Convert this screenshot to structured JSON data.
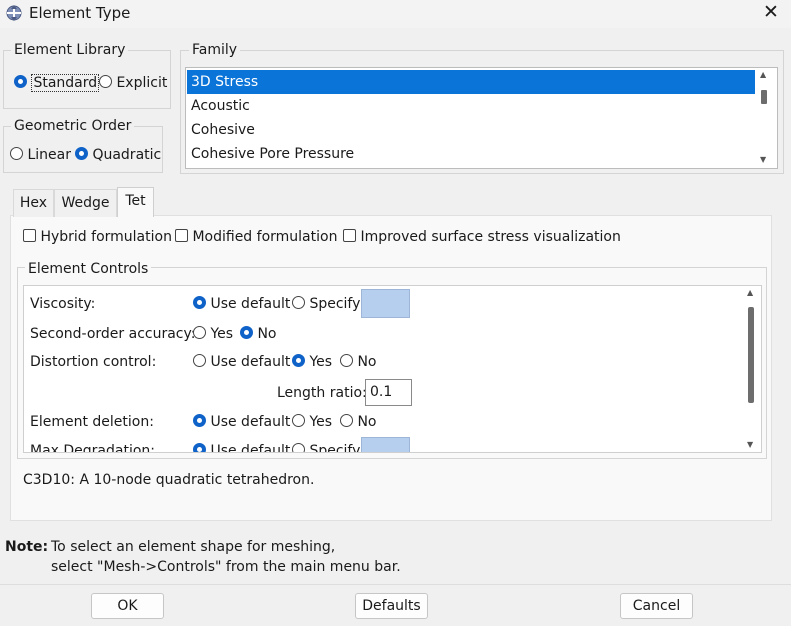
{
  "window": {
    "title": "Element Type",
    "close_glyph": "✕"
  },
  "element_library": {
    "legend": "Element Library",
    "options": [
      {
        "label": "Standard",
        "selected": true
      },
      {
        "label": "Explicit",
        "selected": false
      }
    ]
  },
  "geometric_order": {
    "legend": "Geometric Order",
    "options": [
      {
        "label": "Linear",
        "selected": false
      },
      {
        "label": "Quadratic",
        "selected": true
      }
    ]
  },
  "family": {
    "legend": "Family",
    "items": [
      "3D Stress",
      "Acoustic",
      "Cohesive",
      "Cohesive Pore Pressure"
    ],
    "selected": "3D Stress"
  },
  "tabs": [
    {
      "label": "Hex",
      "active": false
    },
    {
      "label": "Wedge",
      "active": false
    },
    {
      "label": "Tet",
      "active": true
    }
  ],
  "options": {
    "hybrid": "Hybrid formulation",
    "modified": "Modified formulation",
    "improved": "Improved surface stress visualization"
  },
  "element_controls": {
    "legend": "Element Controls",
    "viscosity": {
      "label": "Viscosity:",
      "use_default": "Use default",
      "specify": "Specify"
    },
    "second_order": {
      "label": "Second-order accuracy:",
      "yes": "Yes",
      "no": "No"
    },
    "distortion": {
      "label": "Distortion control:",
      "use_default": "Use default",
      "yes": "Yes",
      "no": "No"
    },
    "length_ratio": {
      "label": "Length ratio:",
      "value": "0.1"
    },
    "element_deletion": {
      "label": "Element deletion:",
      "use_default": "Use default",
      "yes": "Yes",
      "no": "No"
    },
    "max_degradation": {
      "label": "Max Degradation:",
      "use_default": "Use default",
      "specify": "Specify"
    }
  },
  "description": "C3D10:  A 10-node quadratic tetrahedron.",
  "note": {
    "label": "Note:",
    "line1": "To select an element shape for meshing,",
    "line2": "select \"Mesh->Controls\" from the main menu bar."
  },
  "buttons": {
    "ok": "OK",
    "defaults": "Defaults",
    "cancel": "Cancel"
  },
  "colors": {
    "accent": "#0a74d8",
    "swatch": "#b7cfee"
  }
}
